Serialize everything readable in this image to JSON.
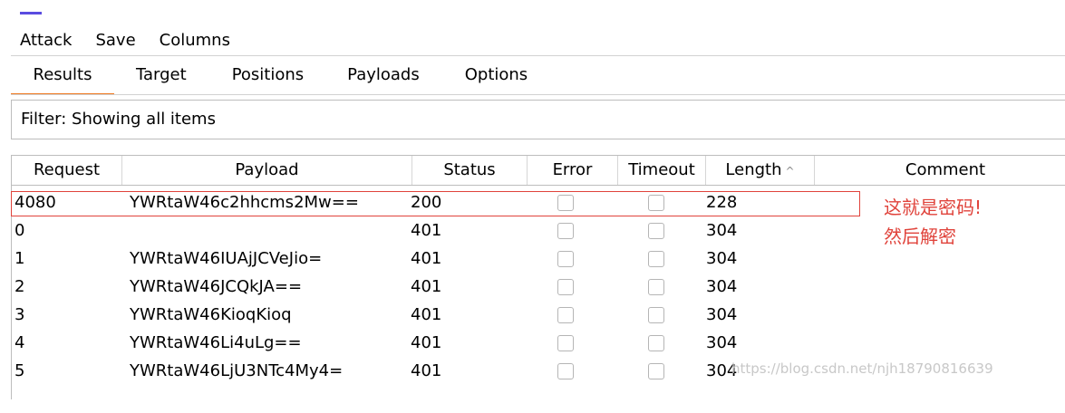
{
  "menu": {
    "attack": "Attack",
    "save": "Save",
    "columns": "Columns"
  },
  "tabs": [
    {
      "label": "Results",
      "active": true
    },
    {
      "label": "Target"
    },
    {
      "label": "Positions"
    },
    {
      "label": "Payloads"
    },
    {
      "label": "Options"
    }
  ],
  "filter": {
    "text": "Filter: Showing all items"
  },
  "table": {
    "columns": [
      "Request",
      "Payload",
      "Status",
      "Error",
      "Timeout",
      "Length",
      "Comment"
    ],
    "sort_indicator": "^",
    "rows": [
      {
        "request": "4080",
        "payload": "YWRtaW46c2hhcms2Mw==",
        "status": "200",
        "error": false,
        "timeout": false,
        "length": "228",
        "comment": ""
      },
      {
        "request": "0",
        "payload": "",
        "status": "401",
        "error": false,
        "timeout": false,
        "length": "304",
        "comment": ""
      },
      {
        "request": "1",
        "payload": "YWRtaW46IUAjJCVeJio=",
        "status": "401",
        "error": false,
        "timeout": false,
        "length": "304",
        "comment": ""
      },
      {
        "request": "2",
        "payload": "YWRtaW46JCQkJA==",
        "status": "401",
        "error": false,
        "timeout": false,
        "length": "304",
        "comment": ""
      },
      {
        "request": "3",
        "payload": "YWRtaW46KioqKioq",
        "status": "401",
        "error": false,
        "timeout": false,
        "length": "304",
        "comment": ""
      },
      {
        "request": "4",
        "payload": "YWRtaW46Li4uLg==",
        "status": "401",
        "error": false,
        "timeout": false,
        "length": "304",
        "comment": ""
      },
      {
        "request": "5",
        "payload": "YWRtaW46LjU3NTc4My4=",
        "status": "401",
        "error": false,
        "timeout": false,
        "length": "304",
        "comment": ""
      }
    ]
  },
  "annotation": {
    "line1": "这就是密码!",
    "line2": "然后解密"
  },
  "watermark": "https://blog.csdn.net/njh18790816639",
  "colors": {
    "accent": "#5a4ce0",
    "tab_underline": "#f07a22",
    "annotation": "#e0433b"
  }
}
